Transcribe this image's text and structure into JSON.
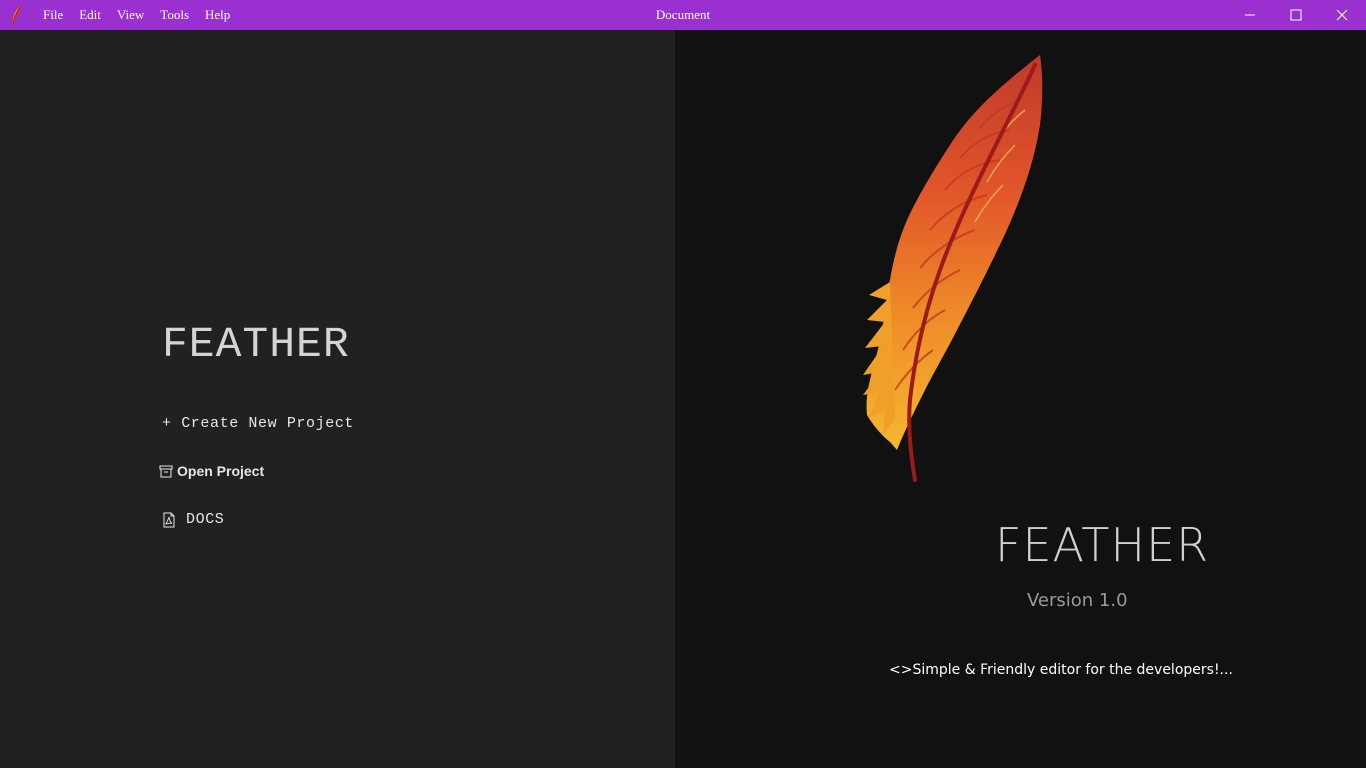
{
  "window": {
    "title": "Document",
    "menu": [
      {
        "label": "File"
      },
      {
        "label": "Edit"
      },
      {
        "label": "View"
      },
      {
        "label": "Tools"
      },
      {
        "label": "Help"
      }
    ],
    "controls": [
      "minimize-icon",
      "maximize-icon",
      "close-icon"
    ]
  },
  "left": {
    "app_name": "FEATHER",
    "actions": {
      "create": "+ Create New Project",
      "open": "Open Project",
      "docs": "DOCS"
    }
  },
  "right": {
    "app_name": "FEATHER",
    "version": "Version 1.0",
    "tagline": "<>Simple & Friendly editor for the developers!..."
  },
  "colors": {
    "titlebar": "#9b30d0",
    "left_panel": "#212121",
    "right_panel": "#111111",
    "feather_top": "#c0392b",
    "feather_bottom": "#f5a623"
  }
}
